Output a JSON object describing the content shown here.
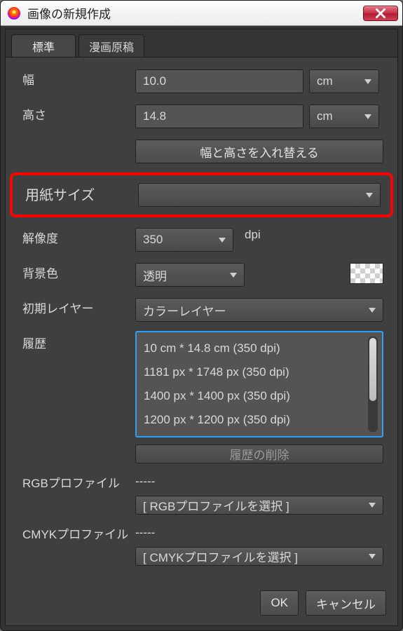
{
  "titlebar": {
    "title": "画像の新規作成"
  },
  "tabs": {
    "standard": "標準",
    "manga": "漫画原稿"
  },
  "fields": {
    "width_label": "幅",
    "width_value": "10.0",
    "width_unit": "cm",
    "height_label": "高さ",
    "height_value": "14.8",
    "height_unit": "cm",
    "swap_label": "幅と高さを入れ替える",
    "papersize_label": "用紙サイズ",
    "papersize_value": "",
    "resolution_label": "解像度",
    "resolution_value": "350",
    "resolution_unit": "dpi",
    "bgcolor_label": "背景色",
    "bgcolor_value": "透明",
    "initlayer_label": "初期レイヤー",
    "initlayer_value": "カラーレイヤー",
    "history_label": "履歴",
    "history_items": [
      "10 cm * 14.8 cm (350 dpi)",
      "1181 px * 1748 px (350 dpi)",
      "1400 px * 1400 px (350 dpi)",
      "1200 px * 1200 px (350 dpi)"
    ],
    "delete_history": "履歴の削除",
    "rgb_profile_label": "RGBプロファイル",
    "rgb_profile_value": "-----",
    "rgb_profile_select": "[ RGBプロファイルを選択 ]",
    "cmyk_profile_label": "CMYKプロファイル",
    "cmyk_profile_value": "-----",
    "cmyk_profile_select": "[ CMYKプロファイルを選択 ]"
  },
  "footer": {
    "ok": "OK",
    "cancel": "キャンセル"
  }
}
